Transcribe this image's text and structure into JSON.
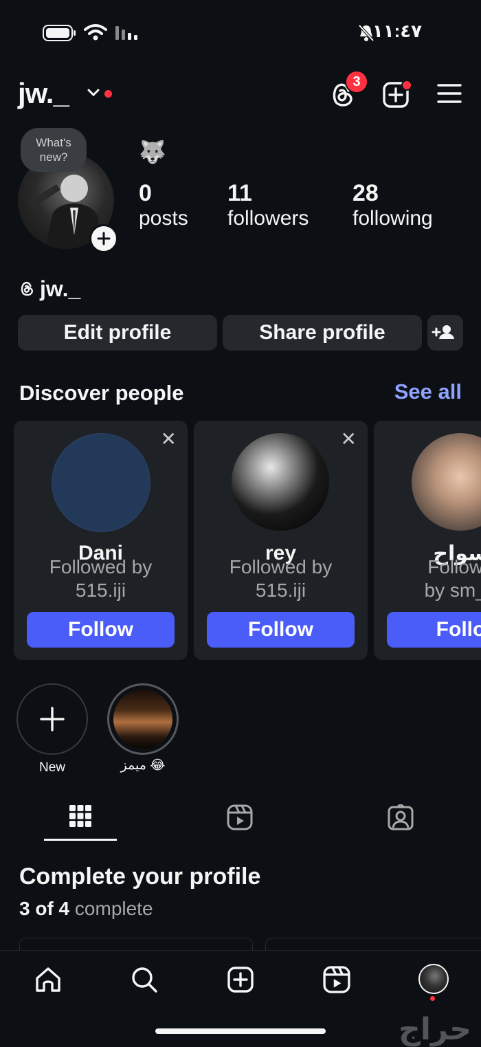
{
  "status_bar": {
    "time": "١١:٤٧"
  },
  "header": {
    "username": "jw._",
    "threads_badge": "3"
  },
  "profile": {
    "bubble_text": "What's new?",
    "emoji": "🐺",
    "posts_count": "0",
    "posts_label": "posts",
    "followers_count": "11",
    "followers_label": "followers",
    "following_count": "28",
    "following_label": "following",
    "threads_handle": "jw._"
  },
  "actions": {
    "edit_label": "Edit profile",
    "share_label": "Share profile"
  },
  "discover": {
    "title": "Discover people",
    "see_all": "See all",
    "cards": [
      {
        "name": "Dani",
        "sub1": "Followed by",
        "sub2": "515.iji",
        "follow": "Follow",
        "close": "✕"
      },
      {
        "name": "rey",
        "sub1": "Followed by",
        "sub2": "515.iji",
        "follow": "Follow",
        "close": "✕"
      },
      {
        "name": "سواح",
        "sub1": "Followe",
        "sub2": "by sm_g",
        "follow": "Follo"
      }
    ]
  },
  "highlights": [
    {
      "label": "New"
    },
    {
      "label": "ميمز 😂"
    }
  ],
  "complete": {
    "title": "Complete your profile",
    "progress_bold": "3 of 4",
    "progress_rest": " complete"
  },
  "watermark": "حراج",
  "colors": {
    "background": "#0c1014",
    "accent": "#4a5df9",
    "link": "#8fa2ff",
    "notification": "#ff3040"
  }
}
